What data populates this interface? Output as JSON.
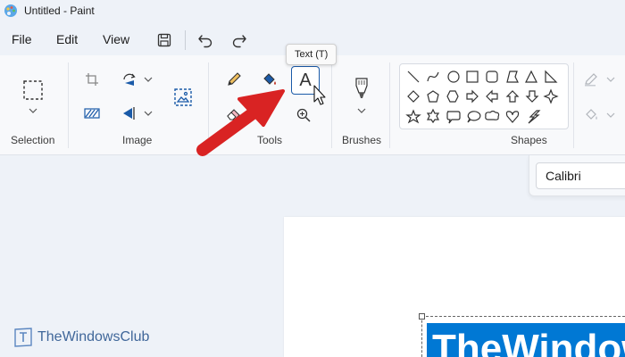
{
  "window": {
    "title": "Untitled - Paint",
    "app_icon": "paint-palette-icon"
  },
  "menu": {
    "items": [
      "File",
      "Edit",
      "View"
    ],
    "quick_access": [
      "save-icon",
      "undo-icon",
      "redo-icon"
    ]
  },
  "ribbon": {
    "groups": {
      "selection": "Selection",
      "image": "Image",
      "tools": "Tools",
      "brushes": "Brushes",
      "shapes": "Shapes"
    }
  },
  "tooltip": {
    "text": "Text (T)"
  },
  "text_tool": {
    "glyph": "A"
  },
  "font": {
    "value": "Calibri"
  },
  "canvas": {
    "text": "TheWindowsClub"
  },
  "watermark": {
    "text": "TheWindowsClub"
  },
  "colors": {
    "accent": "#0078d4",
    "ribbon_bg": "#f8f9fb",
    "window_bg": "#eef2f8",
    "annotation_arrow": "#e02424"
  }
}
